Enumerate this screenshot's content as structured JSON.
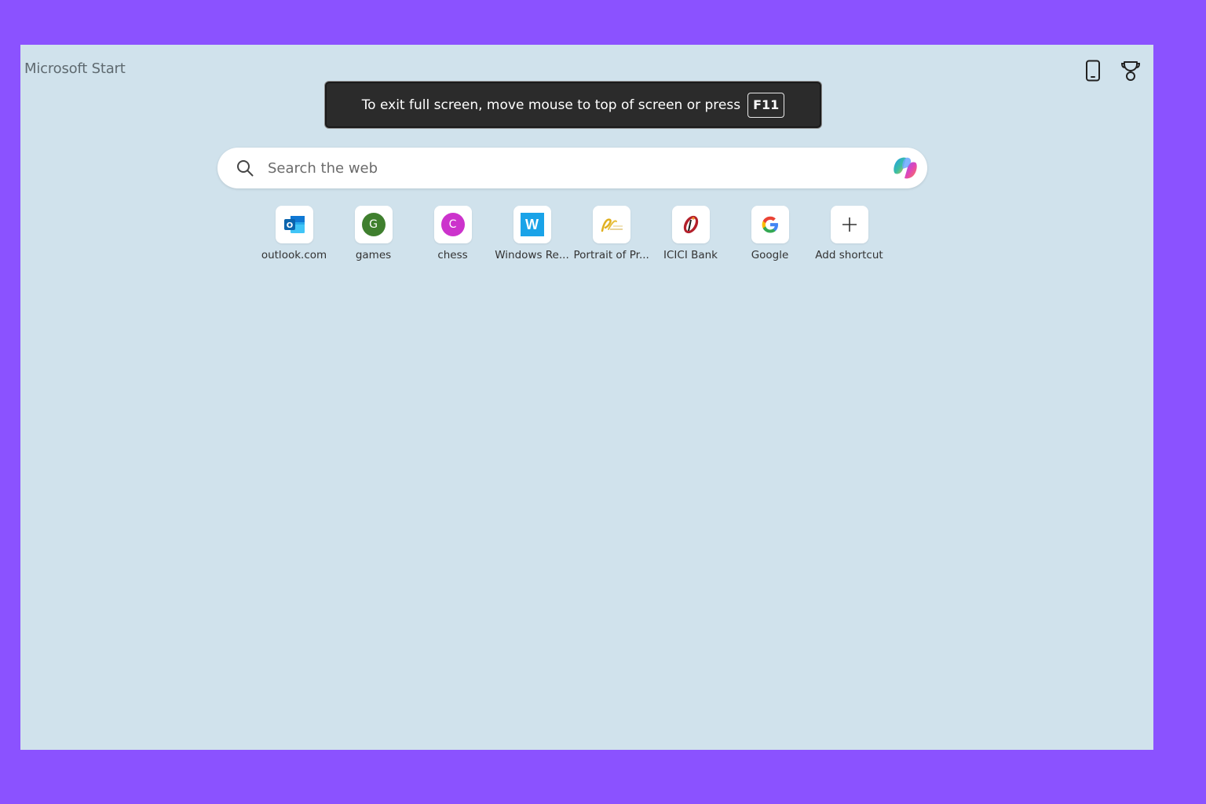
{
  "app": {
    "brand": "Microsoft Start"
  },
  "top_icons": {
    "phone": "phone-icon",
    "rewards": "trophy-icon"
  },
  "fullscreen_toast": {
    "message": "To exit full screen, move mouse to top of screen or press",
    "key": "F11"
  },
  "search": {
    "placeholder": "Search the web",
    "value": ""
  },
  "shortcuts": [
    {
      "label": "outlook.com",
      "icon": "outlook-icon"
    },
    {
      "label": "games",
      "icon": "letter-g-icon",
      "letter": "G",
      "color": "#3f7f2e"
    },
    {
      "label": "chess",
      "icon": "letter-c-icon",
      "letter": "C",
      "color": "#cc33cc"
    },
    {
      "label": "Windows Re...",
      "icon": "windows-report-icon",
      "letter": "W",
      "color": "#1aa3e8"
    },
    {
      "label": "Portrait of Pr...",
      "icon": "portrait-site-icon"
    },
    {
      "label": "ICICI Bank",
      "icon": "icici-bank-icon"
    },
    {
      "label": "Google",
      "icon": "google-icon"
    },
    {
      "label": "Add shortcut",
      "icon": "plus-icon"
    }
  ],
  "colors": {
    "frame": "#8b52ff",
    "page_background": "#d0e2ec",
    "toast_background": "#2b2b2b"
  }
}
